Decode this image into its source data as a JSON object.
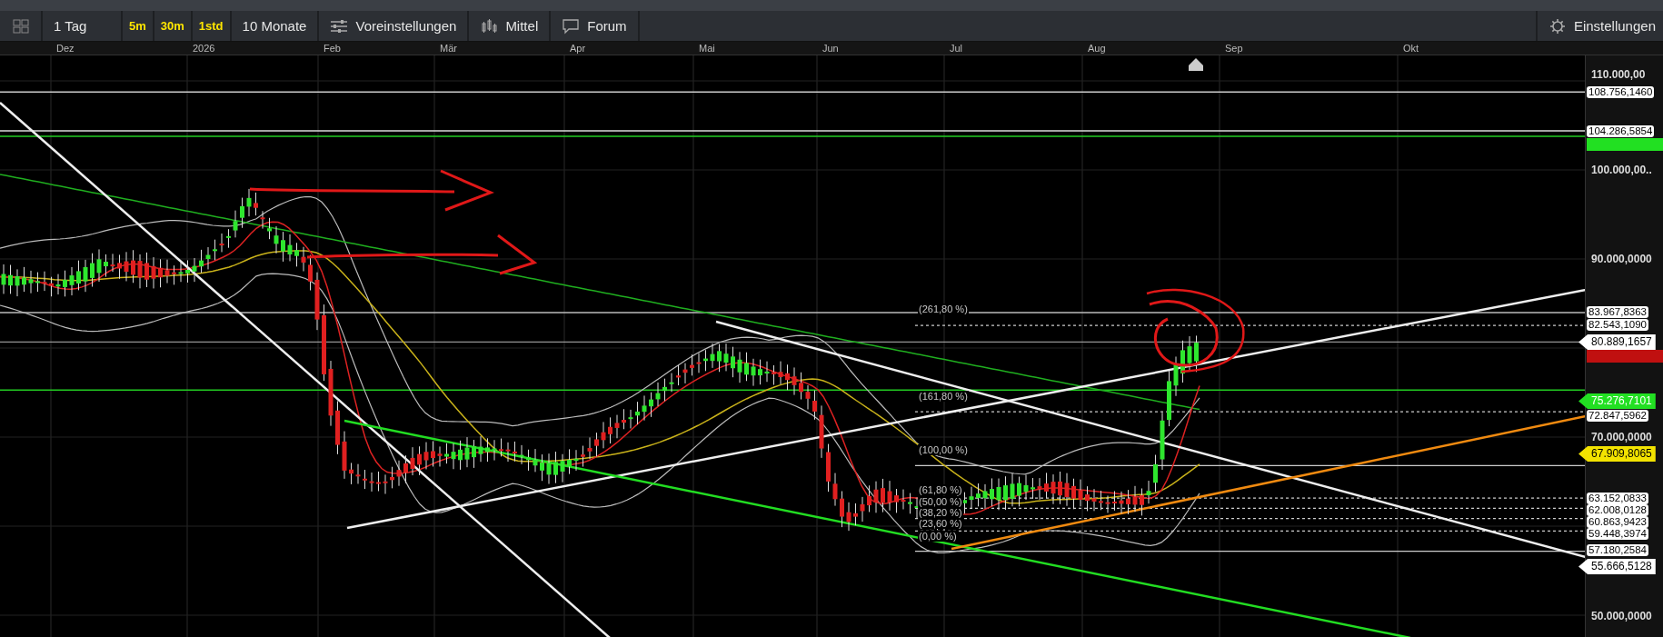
{
  "toolbar": {
    "items": [
      {
        "kind": "dropdown",
        "label": "1 Tag"
      },
      {
        "kind": "quick",
        "label": "5m"
      },
      {
        "kind": "quick",
        "label": "30m"
      },
      {
        "kind": "quick",
        "label": "1std"
      },
      {
        "kind": "dropdown",
        "label": "10 Monate"
      },
      {
        "kind": "sliders",
        "label": "Voreinstellungen"
      },
      {
        "kind": "candles",
        "label": "Mittel"
      },
      {
        "kind": "chat",
        "label": "Forum"
      }
    ],
    "settings_button": {
      "label": "Einstellungen"
    }
  },
  "time_axis": {
    "labels": [
      "Dez",
      "2026",
      "Feb",
      "Mär",
      "Apr",
      "Mai",
      "Jun",
      "Jul",
      "Aug",
      "Sep",
      "Okt"
    ]
  },
  "price_axis": {
    "ticks": [
      "110.000,00",
      "100.000,00..",
      "90.000,0000",
      "70.000,0000",
      "50.000,0000"
    ],
    "tags": [
      {
        "text": "108.756,1460",
        "kind": "box",
        "color": "#ffffff"
      },
      {
        "text": "104.286,5854",
        "kind": "box",
        "color": "#ffffff"
      },
      {
        "text": "83.967,8363",
        "kind": "box",
        "color": "#ffffff"
      },
      {
        "text": "82.543,1090",
        "kind": "box",
        "color": "#ffffff"
      },
      {
        "text": "80.889,1657",
        "kind": "pointer",
        "color": "#ffffff"
      },
      {
        "text": "75.276,7101",
        "kind": "pointer",
        "color": "#22e022"
      },
      {
        "text": "72.847,5962",
        "kind": "box",
        "color": "#ffffff"
      },
      {
        "text": "67.909,8065",
        "kind": "pointer",
        "color": "#f2e200"
      },
      {
        "text": "63.152,0833",
        "kind": "box",
        "color": "#ffffff"
      },
      {
        "text": "62.008,0128",
        "kind": "box",
        "color": "#ffffff"
      },
      {
        "text": "60.863,9423",
        "kind": "box",
        "color": "#ffffff"
      },
      {
        "text": "59.448,3974",
        "kind": "box",
        "color": "#ffffff"
      },
      {
        "text": "57.180,2584",
        "kind": "box",
        "color": "#ffffff"
      },
      {
        "text": "55.666,5128",
        "kind": "pointer",
        "color": "#ffffff"
      }
    ]
  },
  "fibonacci": {
    "levels": [
      "(261,80 %)",
      "(161,80 %)",
      "(100,00 %)",
      "(61,80 %)",
      "(50,00 %)",
      "(38,20 %)",
      "(23,60 %)",
      "(0,00 %)"
    ]
  }
}
